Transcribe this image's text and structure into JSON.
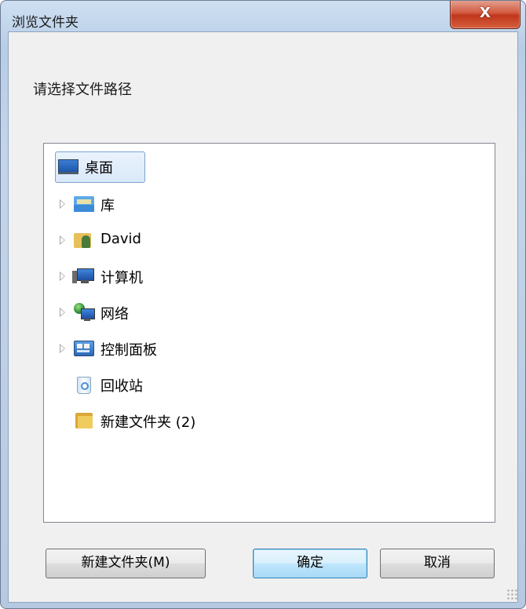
{
  "window": {
    "title": "浏览文件夹",
    "close_glyph": "X"
  },
  "prompt": "请选择文件路径",
  "tree": {
    "items": [
      {
        "label": "桌面",
        "icon": "desktop-icon",
        "expandable": false,
        "selected": true
      },
      {
        "label": "库",
        "icon": "library-icon",
        "expandable": true
      },
      {
        "label": "David",
        "icon": "user-folder-icon",
        "expandable": true
      },
      {
        "label": "计算机",
        "icon": "computer-icon",
        "expandable": true
      },
      {
        "label": "网络",
        "icon": "network-icon",
        "expandable": true
      },
      {
        "label": "控制面板",
        "icon": "control-panel-icon",
        "expandable": true
      },
      {
        "label": "回收站",
        "icon": "recycle-bin-icon",
        "expandable": false
      },
      {
        "label": "新建文件夹 (2)",
        "icon": "folder-icon",
        "expandable": false
      }
    ]
  },
  "buttons": {
    "new_folder": "新建文件夹(M)",
    "ok": "确定",
    "cancel": "取消"
  }
}
